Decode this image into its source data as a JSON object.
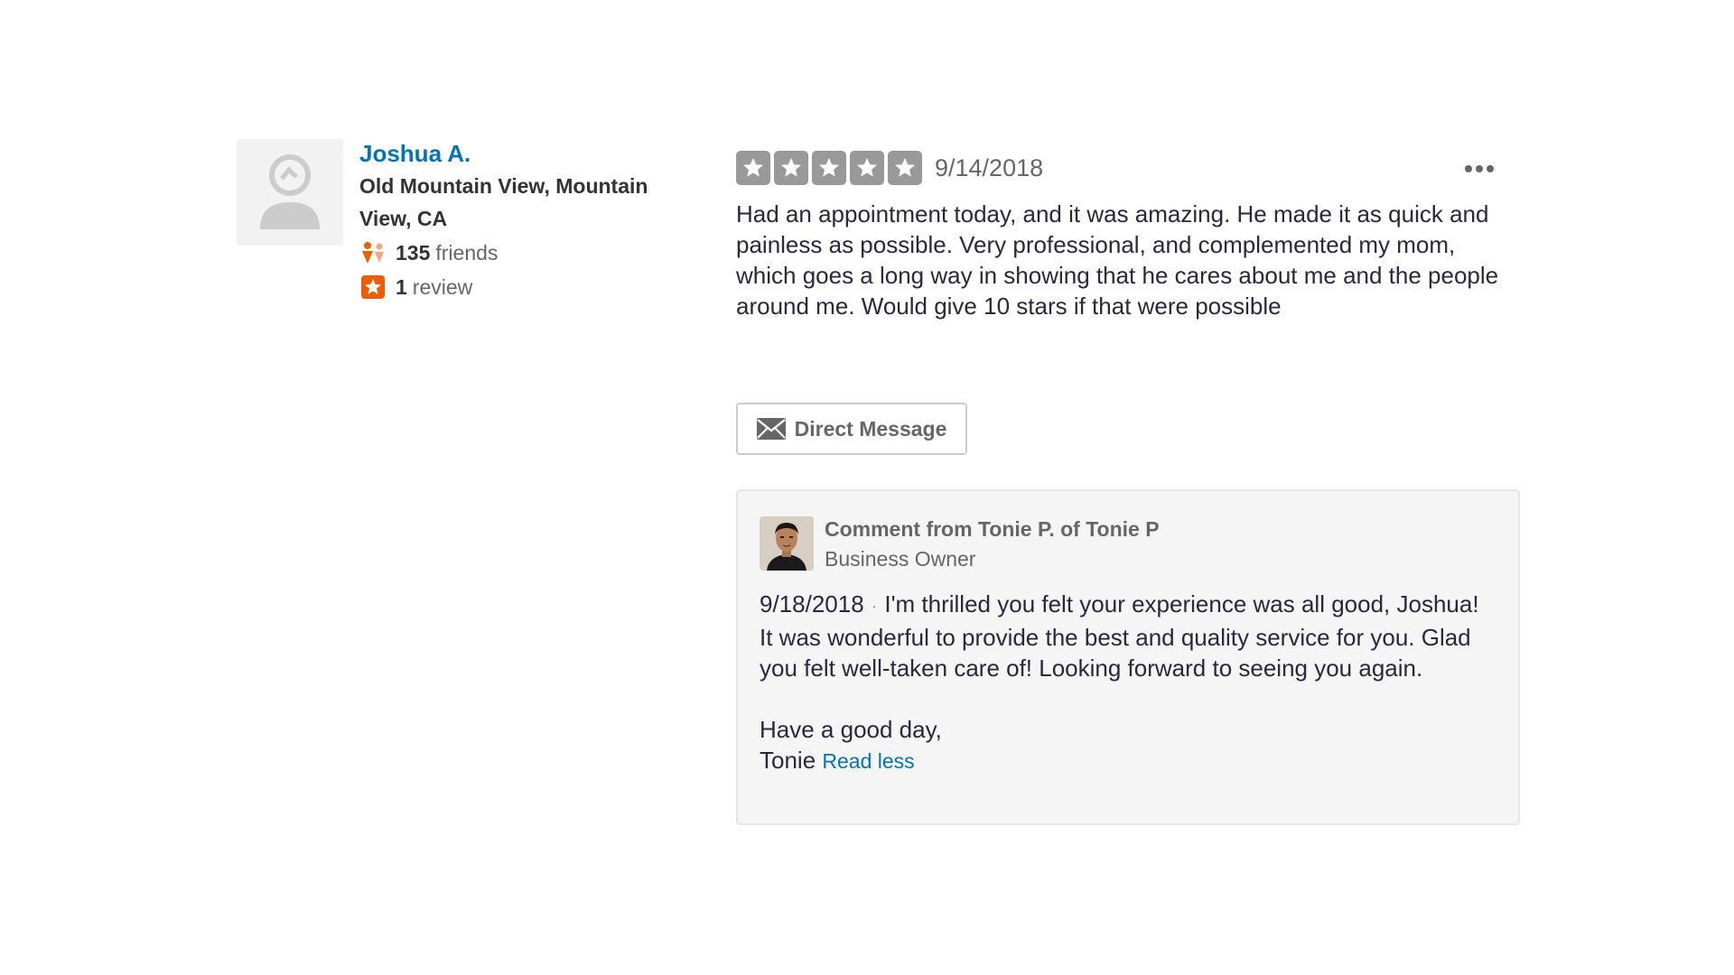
{
  "reviewer": {
    "name": "Joshua A.",
    "location": "Old Mountain View, Mountain View, CA",
    "friends_count": "135",
    "friends_label": "friends",
    "reviews_count": "1",
    "reviews_label": "review"
  },
  "review": {
    "rating": 5,
    "rating_max": 5,
    "date": "9/14/2018",
    "text": "Had an appointment today, and it was amazing. He made it as quick and painless as possible. Very professional, and complemented my mom, which goes a long way in showing that he cares about me and the people around me. Would give 10 stars if that were possible",
    "dm_label": "Direct Message"
  },
  "owner_comment": {
    "title": "Comment from Tonie P. of Tonie P",
    "role": "Business Owner",
    "date": "9/18/2018",
    "separator": "·",
    "text": "I'm thrilled you felt your experience was all good, Joshua! It was wonderful to provide the best and quality service for you. Glad you felt well-taken care of! Looking forward to seeing you again.",
    "signoff": "Have a good day,",
    "signature": "Tonie",
    "read_less": "Read less"
  },
  "colors": {
    "link": "#0073bb",
    "star_empty": "#999999",
    "accent_orange": "#f15c00"
  },
  "icons": {
    "more": "more-dots-icon",
    "friends": "friends-icon",
    "review": "review-star-icon",
    "mail": "mail-icon"
  }
}
